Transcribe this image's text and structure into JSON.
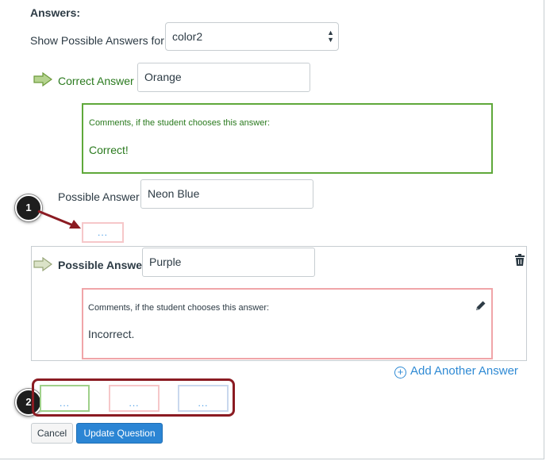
{
  "answers_heading": "Answers:",
  "show_possible_label": "Show Possible Answers for",
  "blank_select": {
    "value": "color2"
  },
  "correct_answer": {
    "label": "Correct Answer",
    "value": "Orange",
    "comment_label": "Comments, if the student chooses this answer:",
    "comment_text": "Correct!"
  },
  "possible_answer_1": {
    "label": "Possible Answer",
    "value": "Neon Blue",
    "comment_placeholder": "..."
  },
  "possible_answer_2": {
    "label": "Possible Answer",
    "value": "Purple",
    "comment_label": "Comments, if the student chooses this answer:",
    "comment_text": "Incorrect."
  },
  "add_answer_label": "Add Another Answer",
  "general_comments": [
    "...",
    "...",
    "..."
  ],
  "callouts": [
    "1",
    "2"
  ],
  "buttons": {
    "cancel": "Cancel",
    "update": "Update Question"
  },
  "icons": {
    "correct_arrow": "arrow-right-icon",
    "possible_arrow": "arrow-right-icon",
    "delete": "trash-icon",
    "edit": "pencil-icon",
    "add": "plus-circle-icon"
  },
  "colors": {
    "correct_green": "#5fa83a",
    "incorrect_red": "#f0a5a8",
    "link_blue": "#2f8ad4",
    "callout_red": "#8b1b22",
    "primary_button": "#2b85d4"
  }
}
